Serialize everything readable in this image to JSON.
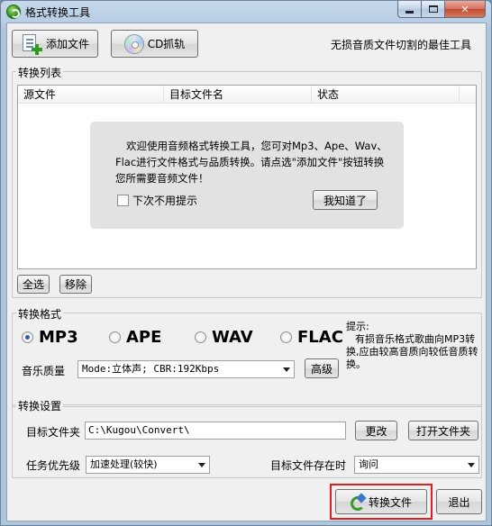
{
  "window": {
    "title": "格式转换工具"
  },
  "toolbar": {
    "add_file": "添加文件",
    "cd_rip": "CD抓轨",
    "slogan": "无损音质文件切割的最佳工具"
  },
  "convert_list": {
    "title": "转换列表",
    "columns": [
      "源文件",
      "目标文件名",
      "状态"
    ],
    "welcome": {
      "message": "欢迎使用音频格式转换工具，您可对Mp3、Ape、Wav、Flac进行文件格式与品质转换。请点选\"添加文件\"按钮转换您所需要音频文件！",
      "dont_show_label": "下次不用提示",
      "ok_button": "我知道了"
    },
    "select_all": "全选",
    "remove": "移除"
  },
  "format": {
    "title": "转换格式",
    "options": [
      {
        "label": "MP3",
        "selected": true
      },
      {
        "label": "APE",
        "selected": false
      },
      {
        "label": "WAV",
        "selected": false
      },
      {
        "label": "FLAC",
        "selected": false
      }
    ],
    "quality_label": "音乐质量",
    "quality_value": "Mode:立体声; CBR:192Kbps",
    "advanced": "高级",
    "tip_title": "提示:",
    "tip_body": "有损音乐格式歌曲向MP3转换,应由较高音质向较低音质转换。"
  },
  "settings": {
    "title": "转换设置",
    "target_folder_label": "目标文件夹",
    "target_folder_value": "C:\\Kugou\\Convert\\",
    "change": "更改",
    "open_folder": "打开文件夹",
    "priority_label": "任务优先级",
    "priority_value": "加速处理(较快)",
    "exists_label": "目标文件存在时",
    "exists_value": "询问"
  },
  "actions": {
    "convert": "转换文件",
    "exit": "退出"
  }
}
